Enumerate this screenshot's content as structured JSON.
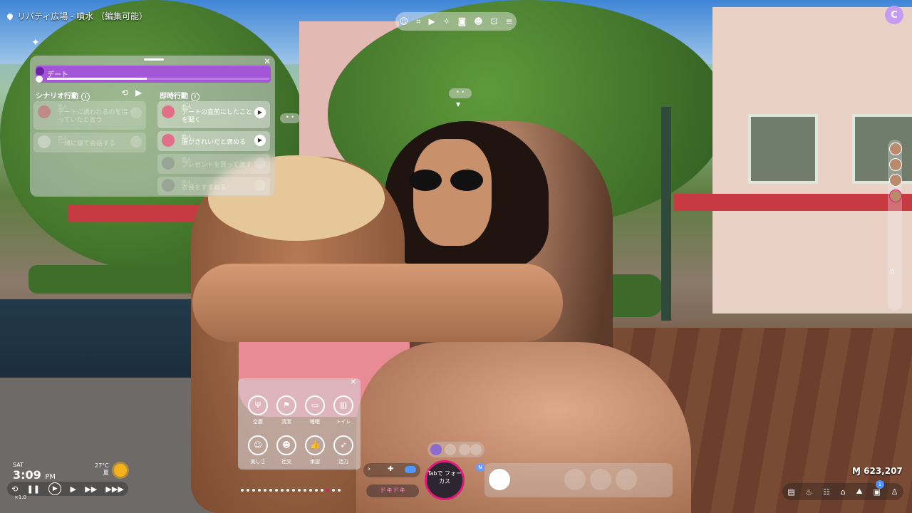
{
  "location": "リバティ広場 - 噴水 （編集可能）",
  "top_toolbar": {
    "icons": [
      "emote-icon",
      "gallery-icon",
      "video-icon",
      "sparkle-icon",
      "camera-icon",
      "face-icon",
      "capture-icon",
      "menu-icon"
    ]
  },
  "user_avatar_letter": "C",
  "activity_panel": {
    "current_activity": "デート",
    "progress": 0.45,
    "scenario_header": "シナリオ行動",
    "instant_header": "即時行動",
    "scenario_items": [
      {
        "tag": "恋人",
        "text": "デートに誘われるのを待っていたと言う"
      },
      {
        "tag": "恋人",
        "text": "一緒に寝て会話する"
      }
    ],
    "instant_items": [
      {
        "tag": "恋人",
        "text": "デートの直前にしたことを聞く"
      },
      {
        "tag": "恋人",
        "text": "服がきれいだと褒める"
      },
      {
        "tag": "恋人",
        "text": "プレゼントを買って渡す"
      },
      {
        "tag": "恋人",
        "text": "衣装をすすめる"
      }
    ]
  },
  "needs": [
    {
      "label": "空腹",
      "icon": "fork-knife-icon"
    },
    {
      "label": "清潔",
      "icon": "flag-icon"
    },
    {
      "label": "睡眠",
      "icon": "bed-icon"
    },
    {
      "label": "トイレ",
      "icon": "toilet-icon"
    },
    {
      "label": "楽しさ",
      "icon": "smile-icon"
    },
    {
      "label": "社交",
      "icon": "people-icon"
    },
    {
      "label": "承認",
      "icon": "thumbs-up-icon"
    },
    {
      "label": "活力",
      "icon": "run-icon"
    }
  ],
  "clock": {
    "day": "SAT",
    "time": "3:09",
    "ampm": "PM"
  },
  "weather": {
    "temp": "27°C",
    "season": "夏"
  },
  "speed": {
    "label": "×1.0"
  },
  "mood": "ドキドキ",
  "focus_button": "Tabで フォーカス",
  "n_badge": "N",
  "money": "Ɱ 623,207",
  "bottom_badge": "1",
  "colors": {
    "accent_purple": "#a356d6",
    "mood_pink": "#e0197a"
  }
}
